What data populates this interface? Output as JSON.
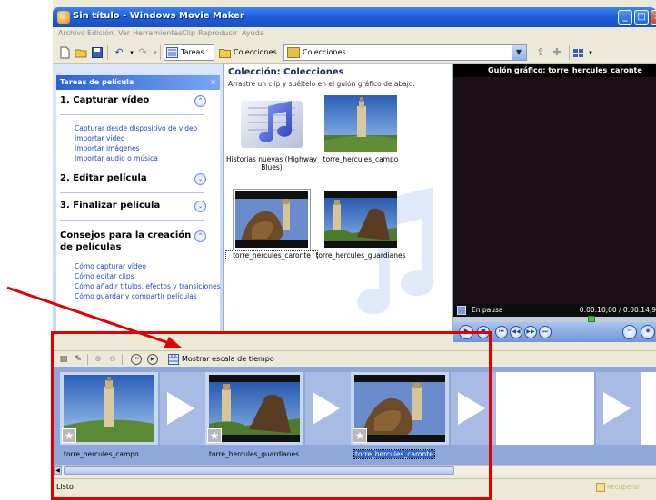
{
  "window": {
    "title": "Sin título - Windows Movie Maker"
  },
  "menu": [
    "Archivo",
    "Edición",
    "Ver",
    "Herramientas",
    "Clip",
    "Reproducir",
    "Ayuda"
  ],
  "toolbar": {
    "tareas_label": "Tareas",
    "colecciones_label": "Colecciones",
    "collection_select": "Colecciones"
  },
  "taskpane": {
    "header": "Tareas de película",
    "close": "×",
    "sections": [
      {
        "title": "1. Capturar vídeo",
        "state": "collapse",
        "links": [
          "Capturar desde dispositivo de vídeo",
          "Importar vídeo",
          "Importar imágenes",
          "Importar audio o música"
        ]
      },
      {
        "title": "2. Editar película",
        "state": "expand",
        "links": []
      },
      {
        "title": "3. Finalizar película",
        "state": "expand",
        "links": []
      },
      {
        "title_line1": "Consejos para la creación",
        "title_line2": "de películas",
        "state": "collapse",
        "links": [
          "Cómo capturar vídeo",
          "Cómo editar clips",
          "Cómo añadir títulos, efectos y transiciones",
          "Cómo guardar y compartir películas"
        ]
      }
    ]
  },
  "collection": {
    "title": "Colección: Colecciones",
    "subtitle": "Arrastre un clip y suéltelo en el guión gráfico de abajo.",
    "clips": [
      {
        "caption_line1": "Historias nuevas (Highway",
        "caption_line2": "Blues)"
      },
      {
        "caption_line1": "torre_hercules_campo",
        "caption_line2": ""
      },
      {
        "caption_line1": "torre_hercules_caronte",
        "caption_line2": ""
      },
      {
        "caption_line1": "torre_hercules_guardianes",
        "caption_line2": ""
      }
    ]
  },
  "monitor": {
    "title": "Guión gráfico: torre_hercules_caronte",
    "status": "En pausa",
    "time": "0:00:10,00 / 0:00:14,9"
  },
  "storyboard": {
    "show_timeline_label": "Mostrar escala de tiempo",
    "clips": [
      "torre_hercules_campo",
      "torre_hercules_guardianes",
      "torre_hercules_caronte"
    ]
  },
  "status": {
    "text": "Listo",
    "right": "Recuperar"
  },
  "colors": {
    "annotation": "#e10000",
    "titlebar": "#1f5fd8",
    "link": "#2249b7"
  }
}
